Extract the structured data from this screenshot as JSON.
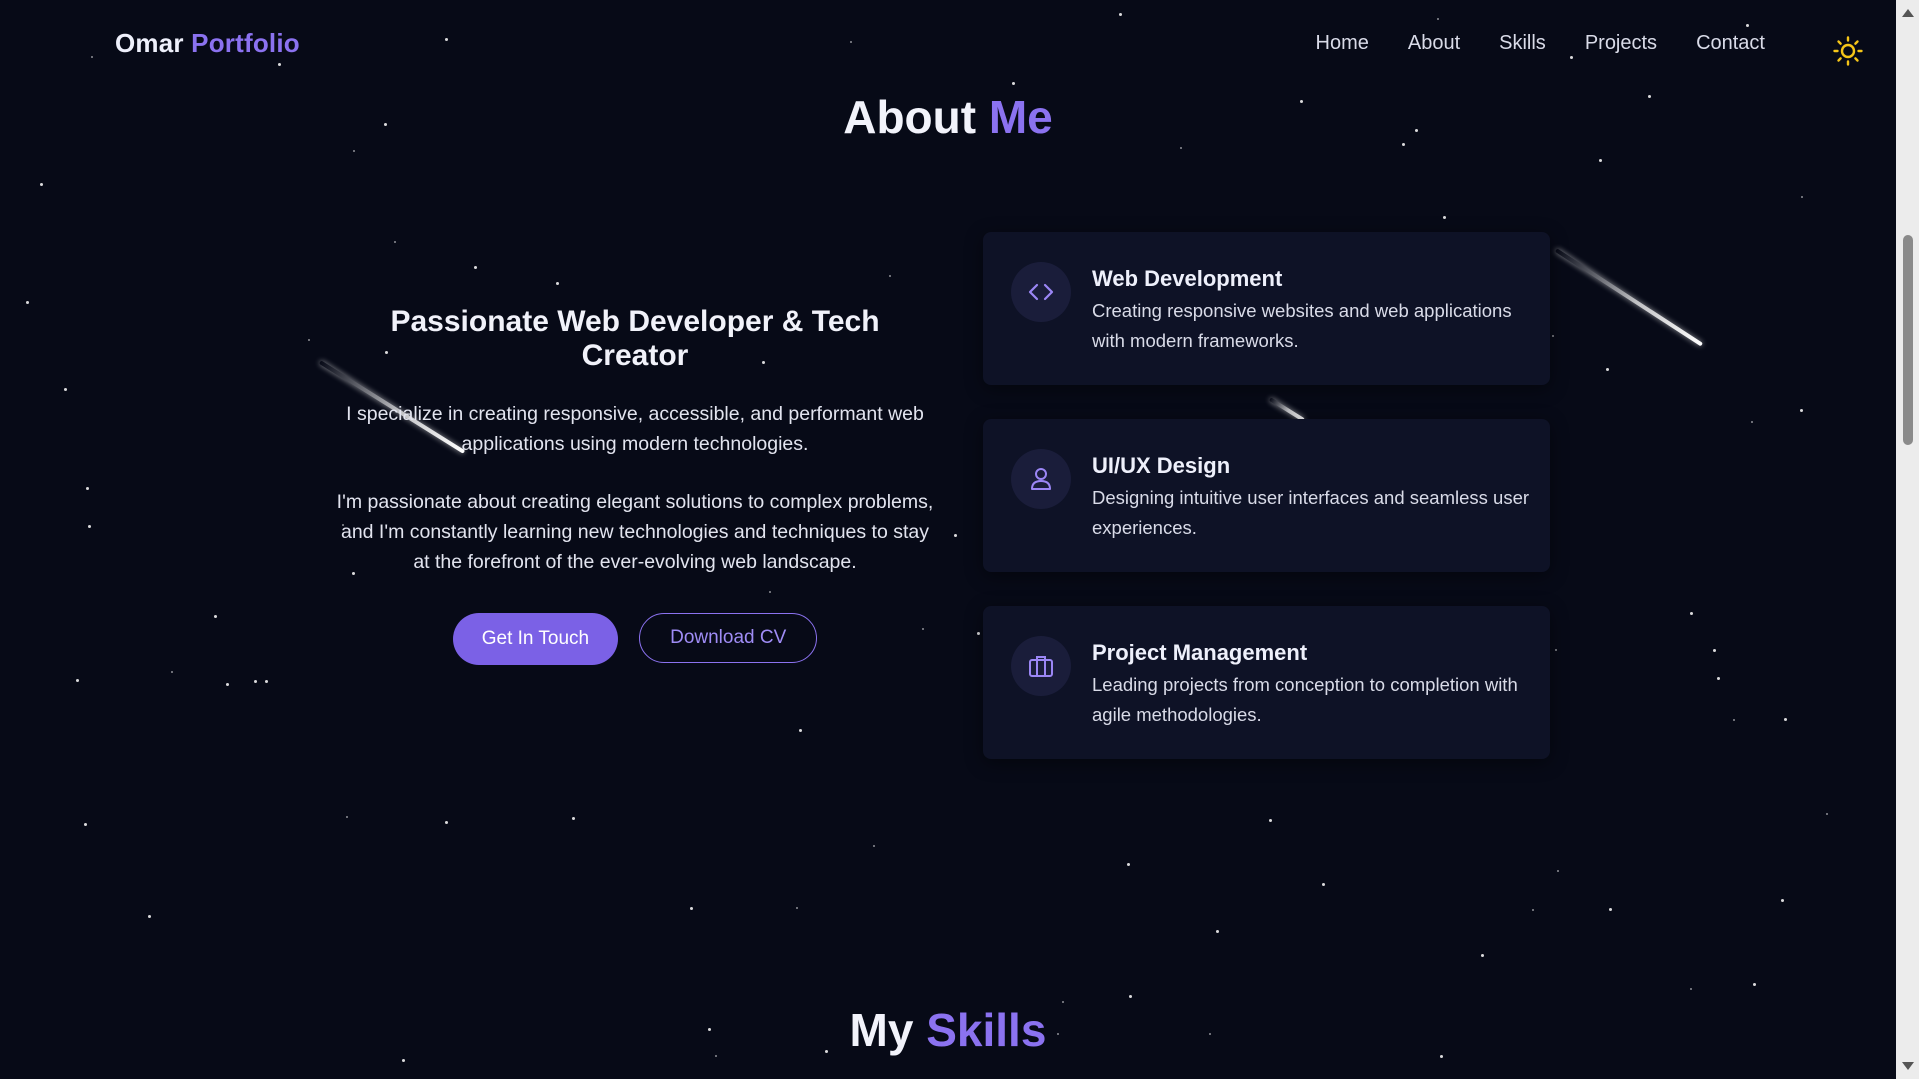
{
  "header": {
    "logo_first": "Omar",
    "logo_second": "Portfolio",
    "nav_items": [
      "Home",
      "About",
      "Skills",
      "Projects",
      "Contact"
    ],
    "theme_icon": "sun-icon"
  },
  "about": {
    "title_main": "About",
    "title_accent": "Me",
    "heading": "Passionate Web Developer & Tech Creator",
    "paragraph_1": "I specialize in creating responsive, accessible, and performant web applications using modern technologies.",
    "paragraph_2": "I'm passionate about creating elegant solutions to complex problems, and I'm constantly learning new technologies and techniques to stay at the forefront of the ever-evolving web landscape.",
    "primary_button": "Get In Touch",
    "secondary_button": "Download CV",
    "cards": [
      {
        "icon": "code-icon",
        "title": "Web Development",
        "description": "Creating responsive websites and web applications with modern frameworks."
      },
      {
        "icon": "user-icon",
        "title": "UI/UX Design",
        "description": "Designing intuitive user interfaces and seamless user experiences."
      },
      {
        "icon": "briefcase-icon",
        "title": "Project Management",
        "description": "Leading projects from conception to completion with agile methodologies."
      }
    ]
  },
  "skills": {
    "title_main": "My",
    "title_accent": "Skills"
  },
  "colors": {
    "background": "#070a17",
    "accent": "#8b72f0",
    "button_primary": "#7b61e6",
    "card_background": "#0e1226",
    "theme_icon": "#f5c518"
  }
}
